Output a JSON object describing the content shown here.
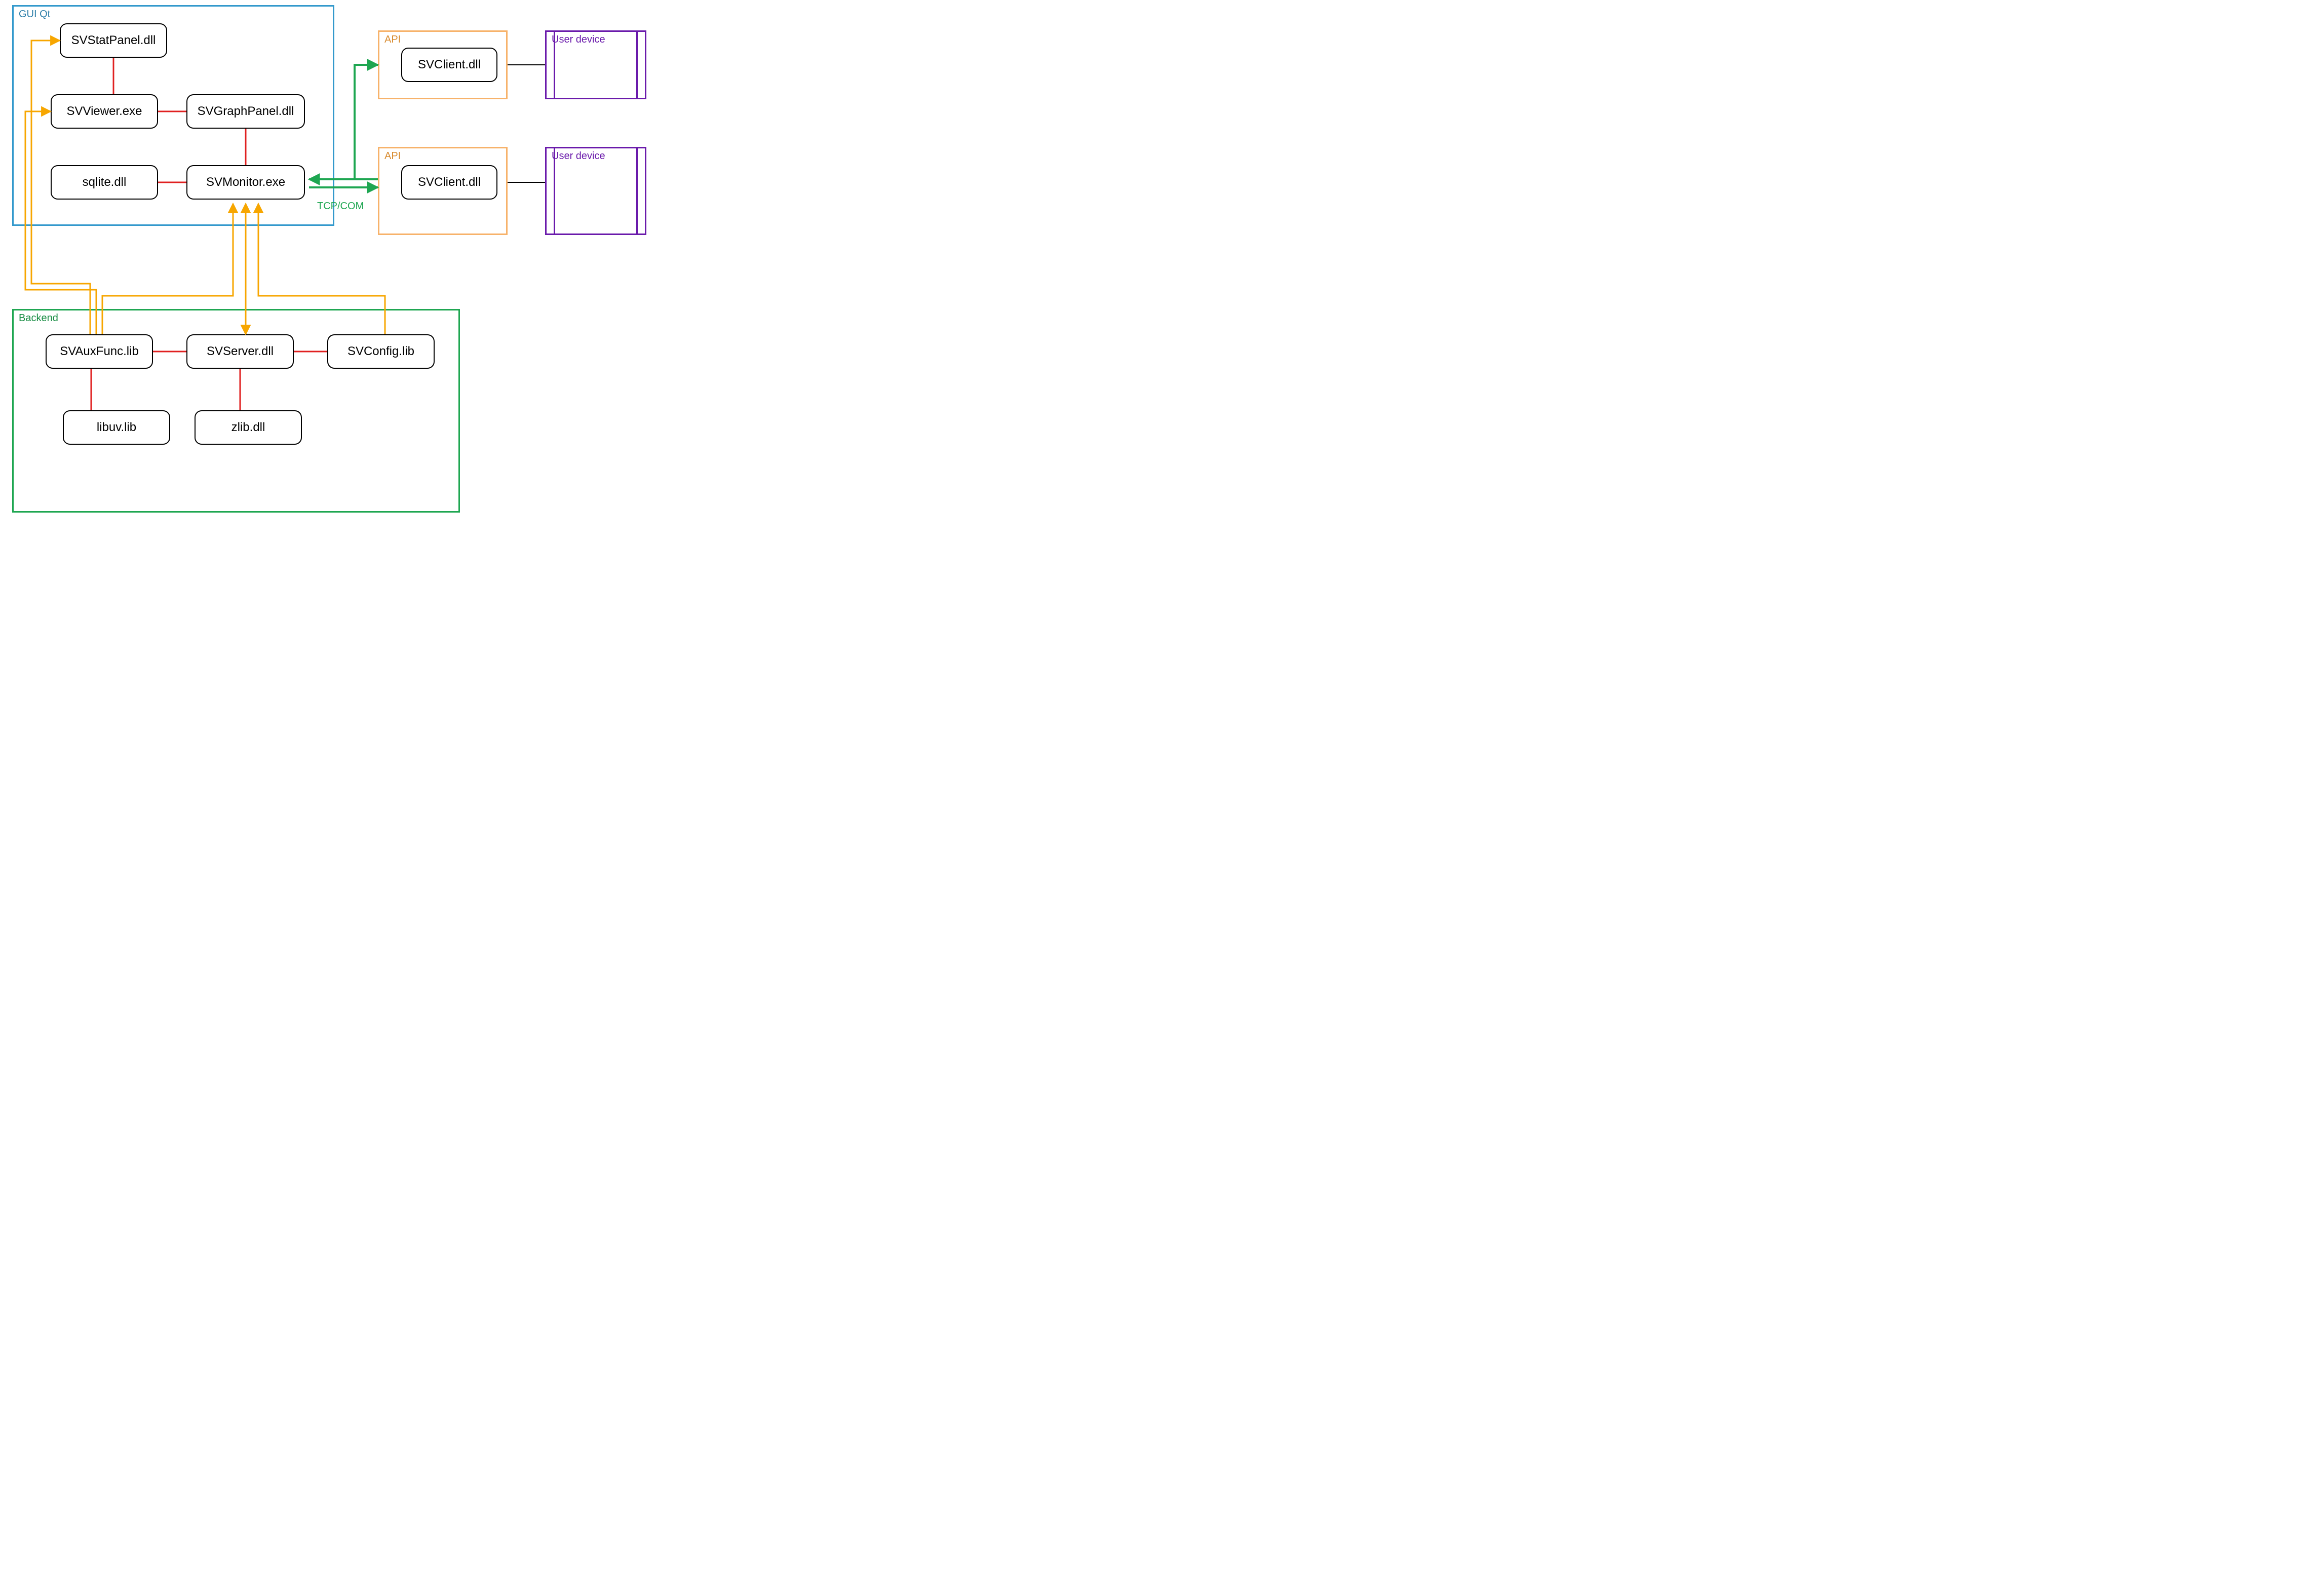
{
  "colors": {
    "gui_border": "#3399cc",
    "gui_text": "#2b7da8",
    "api_border": "#f7b26a",
    "api_text": "#d88b2f",
    "backend_border": "#1ea651",
    "backend_text": "#138a3f",
    "device_border": "#6a1aab",
    "device_text": "#6a1aab",
    "link_red": "#e02020",
    "link_green": "#1ea651",
    "link_yellow": "#f7a600",
    "link_black": "#000000",
    "tcp_text": "#1ea651"
  },
  "groups": {
    "gui": {
      "label": "GUI Qt"
    },
    "backend": {
      "label": "Backend"
    },
    "api1": {
      "label": "API"
    },
    "api2": {
      "label": "API"
    },
    "device1": {
      "label": "User device"
    },
    "device2": {
      "label": "User device"
    }
  },
  "nodes": {
    "svstatpanel": {
      "label": "SVStatPanel.dll"
    },
    "svviewer": {
      "label": "SVViewer.exe"
    },
    "svgraphpanel": {
      "label": "SVGraphPanel.dll"
    },
    "sqlite": {
      "label": "sqlite.dll"
    },
    "svmonitor": {
      "label": "SVMonitor.exe"
    },
    "svclient1": {
      "label": "SVClient.dll"
    },
    "svclient2": {
      "label": "SVClient.dll"
    },
    "svauxfunc": {
      "label": "SVAuxFunc.lib"
    },
    "svserver": {
      "label": "SVServer.dll"
    },
    "svconfig": {
      "label": "SVConfig.lib"
    },
    "libuv": {
      "label": "libuv.lib"
    },
    "zlib": {
      "label": "zlib.dll"
    }
  },
  "edge_labels": {
    "tcpcom": "TCP/COM"
  }
}
